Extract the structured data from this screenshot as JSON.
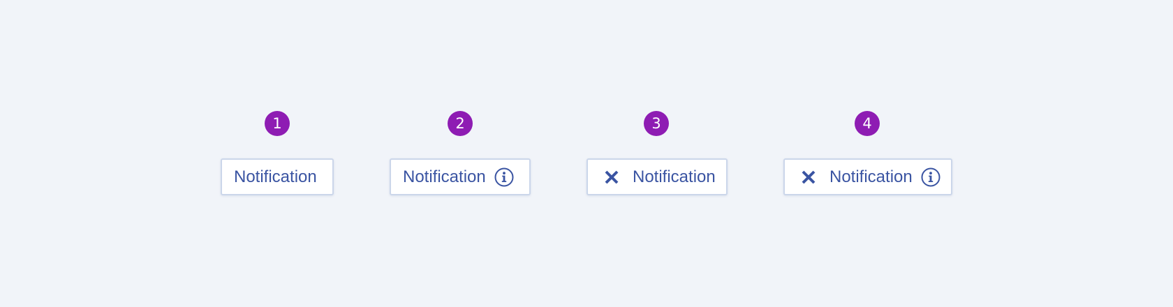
{
  "colors": {
    "background": "#f1f4f9",
    "badge": "#8e1cb3",
    "tag_text": "#3a54a2",
    "tag_border": "#cbd6ea",
    "tag_fill": "#ffffff"
  },
  "variants": [
    {
      "number": "1",
      "label": "Notification",
      "close_icon": false,
      "info_icon": false
    },
    {
      "number": "2",
      "label": "Notification",
      "close_icon": false,
      "info_icon": true
    },
    {
      "number": "3",
      "label": "Notification",
      "close_icon": true,
      "info_icon": false
    },
    {
      "number": "4",
      "label": "Notification",
      "close_icon": true,
      "info_icon": true
    }
  ]
}
